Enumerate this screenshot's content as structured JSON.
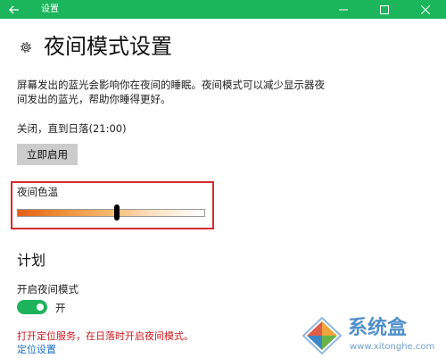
{
  "window": {
    "title": "设置",
    "accent_color": "#1bb55c",
    "back_icon": "back-arrow-icon",
    "controls": [
      "minimize-icon",
      "maximize-icon",
      "close-icon"
    ]
  },
  "page": {
    "icon": "gear-icon",
    "title": "夜间模式设置",
    "description": "屏幕发出的蓝光会影响你在夜间的睡眠。夜间模式可以减少显示器夜间发出的蓝光，帮助你睡得更好。",
    "status": "关闭，直到日落(21:00)",
    "enable_button": "立即启用"
  },
  "color_temp": {
    "label": "夜间色温",
    "value_fraction": 0.53,
    "gradient_colors": [
      "#e45f1a",
      "#ffffff"
    ],
    "highlight_color": "#d42b2b"
  },
  "schedule": {
    "heading": "计划",
    "toggle_label": "开启夜间模式",
    "toggle_on": true,
    "toggle_state": "开",
    "toggle_color": "#1db35a",
    "warning": "打开定位服务，在日落时开启夜间模式。",
    "warning_color": "#c8191d",
    "link": "定位设置",
    "link_color": "#1a6fbe"
  },
  "watermark": {
    "text": "系统盒",
    "url": "www.xitonghe.com"
  }
}
